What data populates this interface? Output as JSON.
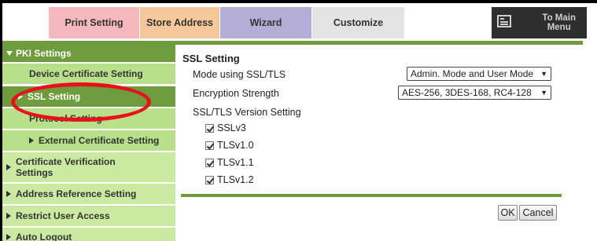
{
  "tabs": {
    "print_setting": "Print Setting",
    "store_address": "Store Address",
    "wizard": "Wizard",
    "customize": "Customize",
    "to_main_menu": "To Main Menu",
    "to_main_line1": "To Main",
    "to_main_line2": "Menu"
  },
  "sidebar": {
    "pki_settings": "PKI Settings",
    "device_certificate_setting": "Device Certificate Setting",
    "ssl_setting": "SSL Setting",
    "protocol_setting": "Protocol Setting",
    "external_certificate_setting": "External Certificate Setting",
    "certificate_verification_line1": "Certificate Verification",
    "certificate_verification_line2": "Settings",
    "address_reference_setting": "Address Reference Setting",
    "restrict_user_access": "Restrict User Access",
    "auto_logout": "Auto Logout"
  },
  "main": {
    "section_title": "SSL Setting",
    "mode_label": "Mode using SSL/TLS",
    "mode_value": "Admin. Mode and User Mode",
    "encryption_label": "Encryption Strength",
    "encryption_value": "AES-256, 3DES-168, RC4-128",
    "version_label": "SSL/TLS Version Setting",
    "versions": [
      {
        "label": "SSLv3",
        "checked": true
      },
      {
        "label": "TLSv1.0",
        "checked": true
      },
      {
        "label": "TLSv1.1",
        "checked": true
      },
      {
        "label": "TLSv1.2",
        "checked": true
      }
    ],
    "ok_button": "OK",
    "cancel_button": "Cancel"
  },
  "colors": {
    "accent_green": "#6e9c3c",
    "light_green": "#b8e08a",
    "annotation_red": "#e8111a",
    "tab_print": "#f5b9bd",
    "tab_store": "#f6c79a",
    "tab_wizard": "#b4aed6"
  },
  "icons": {
    "main_menu": "main-menu-icon",
    "dropdown": "dropdown-arrow-icon"
  }
}
